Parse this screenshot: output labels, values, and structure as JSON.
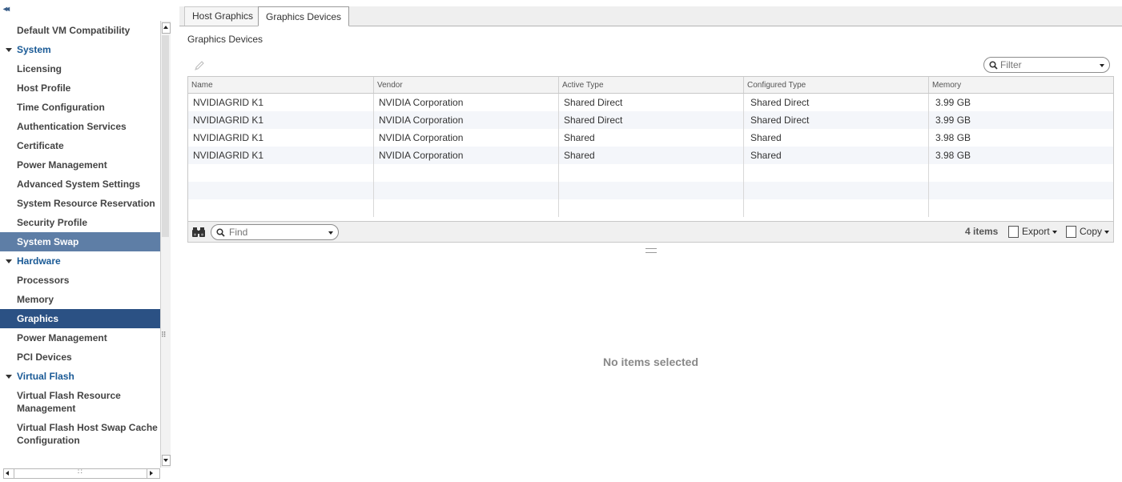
{
  "sidebar": {
    "collapse_glyph": "◂◂",
    "items": [
      {
        "label": "Default VM Compatibility",
        "kind": "item"
      },
      {
        "label": "System",
        "kind": "group"
      },
      {
        "label": "Licensing",
        "kind": "item"
      },
      {
        "label": "Host Profile",
        "kind": "item"
      },
      {
        "label": "Time Configuration",
        "kind": "item"
      },
      {
        "label": "Authentication Services",
        "kind": "item"
      },
      {
        "label": "Certificate",
        "kind": "item"
      },
      {
        "label": "Power Management",
        "kind": "item"
      },
      {
        "label": "Advanced System Settings",
        "kind": "item"
      },
      {
        "label": "System Resource Reservation",
        "kind": "item"
      },
      {
        "label": "Security Profile",
        "kind": "item"
      },
      {
        "label": "System Swap",
        "kind": "item",
        "state": "hover"
      },
      {
        "label": "Hardware",
        "kind": "group"
      },
      {
        "label": "Processors",
        "kind": "item"
      },
      {
        "label": "Memory",
        "kind": "item"
      },
      {
        "label": "Graphics",
        "kind": "item",
        "state": "selected"
      },
      {
        "label": "Power Management",
        "kind": "item"
      },
      {
        "label": "PCI Devices",
        "kind": "item"
      },
      {
        "label": "Virtual Flash",
        "kind": "group"
      },
      {
        "label": "Virtual Flash Resource Management",
        "kind": "item",
        "two_line": true
      },
      {
        "label": "Virtual Flash Host Swap Cache Configuration",
        "kind": "item",
        "two_line": true
      }
    ]
  },
  "tabs": [
    {
      "label": "Host Graphics",
      "active": false
    },
    {
      "label": "Graphics Devices",
      "active": true
    }
  ],
  "section_title": "Graphics Devices",
  "filter": {
    "placeholder": "Filter",
    "value": ""
  },
  "table": {
    "columns": [
      "Name",
      "Vendor",
      "Active Type",
      "Configured Type",
      "Memory"
    ],
    "rows": [
      [
        "NVIDIAGRID K1",
        "NVIDIA Corporation",
        "Shared Direct",
        "Shared Direct",
        "3.99 GB"
      ],
      [
        "NVIDIAGRID K1",
        "NVIDIA Corporation",
        "Shared Direct",
        "Shared Direct",
        "3.99 GB"
      ],
      [
        "NVIDIAGRID K1",
        "NVIDIA Corporation",
        "Shared",
        "Shared",
        "3.98 GB"
      ],
      [
        "NVIDIAGRID K1",
        "NVIDIA Corporation",
        "Shared",
        "Shared",
        "3.98 GB"
      ]
    ]
  },
  "footer": {
    "find_placeholder": "Find",
    "item_count": "4 items",
    "export_label": "Export",
    "copy_label": "Copy"
  },
  "details": {
    "empty_message": "No items selected"
  },
  "colors": {
    "selected_bg": "#2b5184",
    "hover_bg": "#5e7ea6",
    "group_text": "#1a5a96"
  }
}
